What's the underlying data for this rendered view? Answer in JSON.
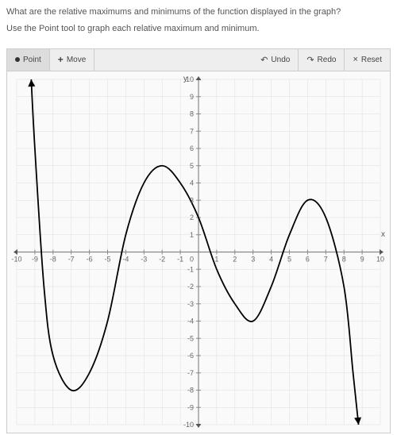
{
  "question": "What are the relative maximums and minimums of the function displayed in the graph?",
  "instruction": "Use the Point tool to graph each relative maximum and minimum.",
  "toolbar": {
    "point_label": "Point",
    "move_label": "Move",
    "undo_label": "Undo",
    "redo_label": "Redo",
    "reset_label": "Reset"
  },
  "axis": {
    "x_label": "x",
    "y_label": "y"
  },
  "chart_data": {
    "type": "line",
    "title": "",
    "xlabel": "x",
    "ylabel": "y",
    "xlim": [
      -10,
      10
    ],
    "ylim": [
      -10,
      10
    ],
    "grid": true,
    "curve_points": [
      {
        "x": -9.2,
        "y": 10
      },
      {
        "x": -9,
        "y": 6
      },
      {
        "x": -8.5,
        "y": -2
      },
      {
        "x": -8,
        "y": -6
      },
      {
        "x": -7,
        "y": -8
      },
      {
        "x": -6,
        "y": -7
      },
      {
        "x": -5,
        "y": -4
      },
      {
        "x": -4,
        "y": 1
      },
      {
        "x": -3,
        "y": 4
      },
      {
        "x": -2,
        "y": 5
      },
      {
        "x": -1,
        "y": 4
      },
      {
        "x": 0,
        "y": 2
      },
      {
        "x": 1,
        "y": -1
      },
      {
        "x": 2,
        "y": -3
      },
      {
        "x": 3,
        "y": -4
      },
      {
        "x": 4,
        "y": -2
      },
      {
        "x": 5,
        "y": 1
      },
      {
        "x": 6,
        "y": 3
      },
      {
        "x": 7,
        "y": 2
      },
      {
        "x": 8,
        "y": -2
      },
      {
        "x": 8.5,
        "y": -7
      },
      {
        "x": 8.8,
        "y": -10
      }
    ],
    "relative_maxima": [
      {
        "x": -2,
        "y": 5
      },
      {
        "x": 6,
        "y": 3
      }
    ],
    "relative_minima": [
      {
        "x": -7,
        "y": -8
      },
      {
        "x": 3,
        "y": -4
      }
    ]
  }
}
